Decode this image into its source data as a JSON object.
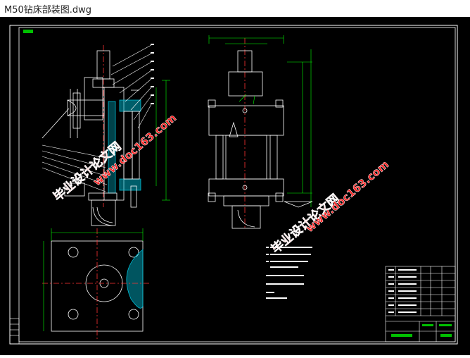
{
  "window": {
    "title": "M50钻床部装图.dwg"
  },
  "drawing": {
    "background": "#000000",
    "colors": {
      "frame": "#ffffff",
      "part": "#ffffff",
      "dimension": "#00ff00",
      "centerline": "#ff3333",
      "hatch": "#00bcd4",
      "watermark": "#ff2020"
    },
    "watermarks": [
      "毕业设计论文网",
      "www.doc163.com",
      "毕业设计论文网",
      "www.doc163.com"
    ]
  }
}
